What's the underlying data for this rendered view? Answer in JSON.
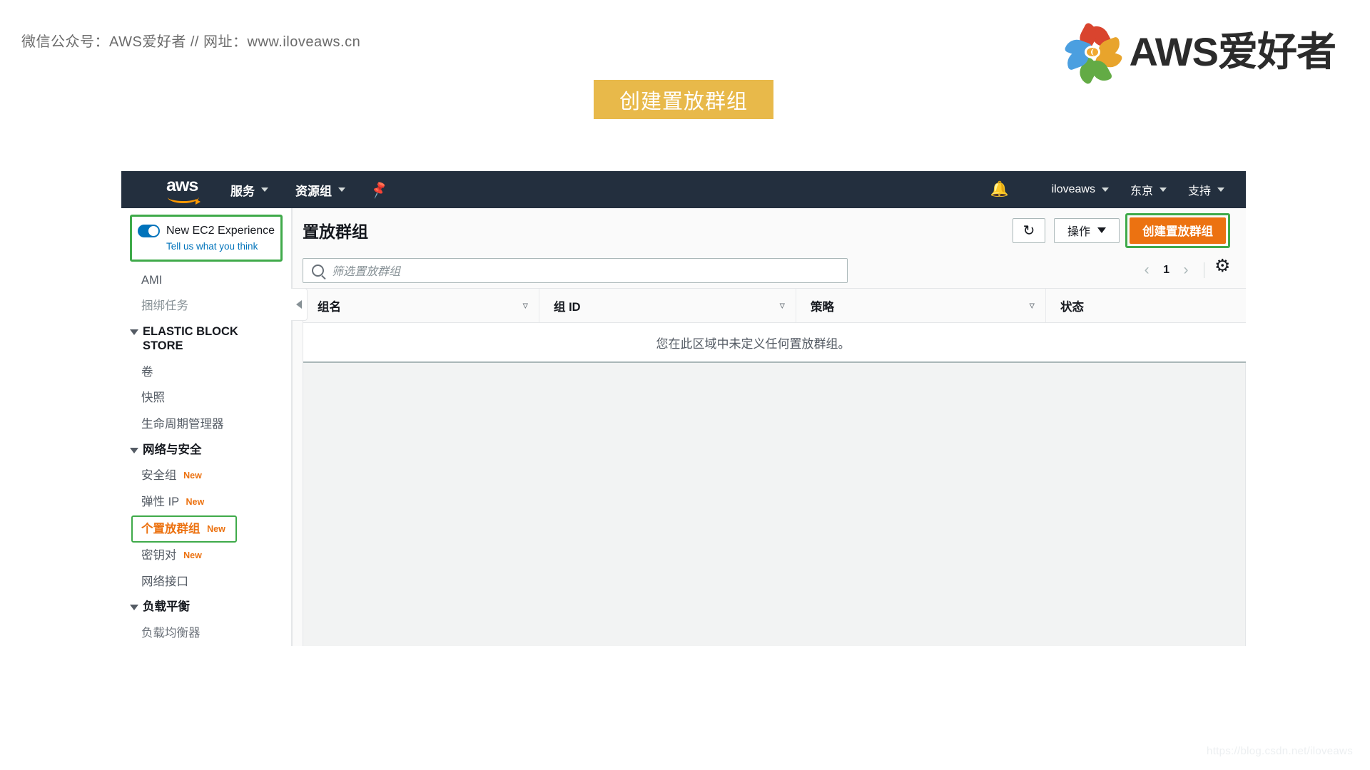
{
  "page": {
    "wechat_line": "微信公众号：AWS爱好者  //  网址：www.iloveaws.cn",
    "brand_text": "AWS爱好者",
    "banner_title": "创建置放群组",
    "watermark": "https://blog.csdn.net/iloveaws",
    "accent_orange": "#ec7211",
    "accent_green": "#3faa4a",
    "banner_gold": "#e8b94a",
    "navbar_bg": "#232f3e"
  },
  "topnav": {
    "logo_text": "aws",
    "services_label": "服务",
    "resource_groups_label": "资源组",
    "pin_icon": "pin-icon",
    "bell_icon": "bell-icon",
    "account_label": "iloveaws",
    "region_label": "东京",
    "support_label": "支持"
  },
  "sidebar": {
    "ec2_experience": {
      "title": "New EC2 Experience",
      "link": "Tell us what you think",
      "toggle_on": true
    },
    "items": [
      {
        "label": "AMI",
        "type": "item",
        "muted": false
      },
      {
        "label": "捆绑任务",
        "type": "item",
        "muted": true
      },
      {
        "label": "ELASTIC BLOCK STORE",
        "type": "group"
      },
      {
        "label": "卷",
        "type": "item",
        "muted": false
      },
      {
        "label": "快照",
        "type": "item",
        "muted": false
      },
      {
        "label": "生命周期管理器",
        "type": "item",
        "muted": false
      },
      {
        "label": "网络与安全",
        "type": "group"
      },
      {
        "label": "安全组",
        "type": "item",
        "badge": "New"
      },
      {
        "label": "弹性 IP",
        "type": "item",
        "badge": "New"
      },
      {
        "label": "个置放群组",
        "type": "item",
        "badge": "New",
        "highlighted": true
      },
      {
        "label": "密钥对",
        "type": "item",
        "badge": "New"
      },
      {
        "label": "网络接口",
        "type": "item"
      },
      {
        "label": "负载平衡",
        "type": "group"
      },
      {
        "label": "负载均衡器",
        "type": "item",
        "clipped": true
      }
    ],
    "collapse_icon": "chevron-left-icon"
  },
  "main": {
    "page_title": "置放群组",
    "refresh_icon": "refresh-icon",
    "actions_label": "操作",
    "create_label": "创建置放群组",
    "search": {
      "placeholder": "筛选置放群组",
      "value": "",
      "icon": "search-icon"
    },
    "pagination": {
      "prev_icon": "chevron-left-icon",
      "page": "1",
      "next_icon": "chevron-right-icon",
      "settings_icon": "gear-icon"
    },
    "table": {
      "columns": [
        "组名",
        "组 ID",
        "策略",
        "状态"
      ],
      "rows": [],
      "empty_message": "您在此区域中未定义任何置放群组。"
    }
  }
}
